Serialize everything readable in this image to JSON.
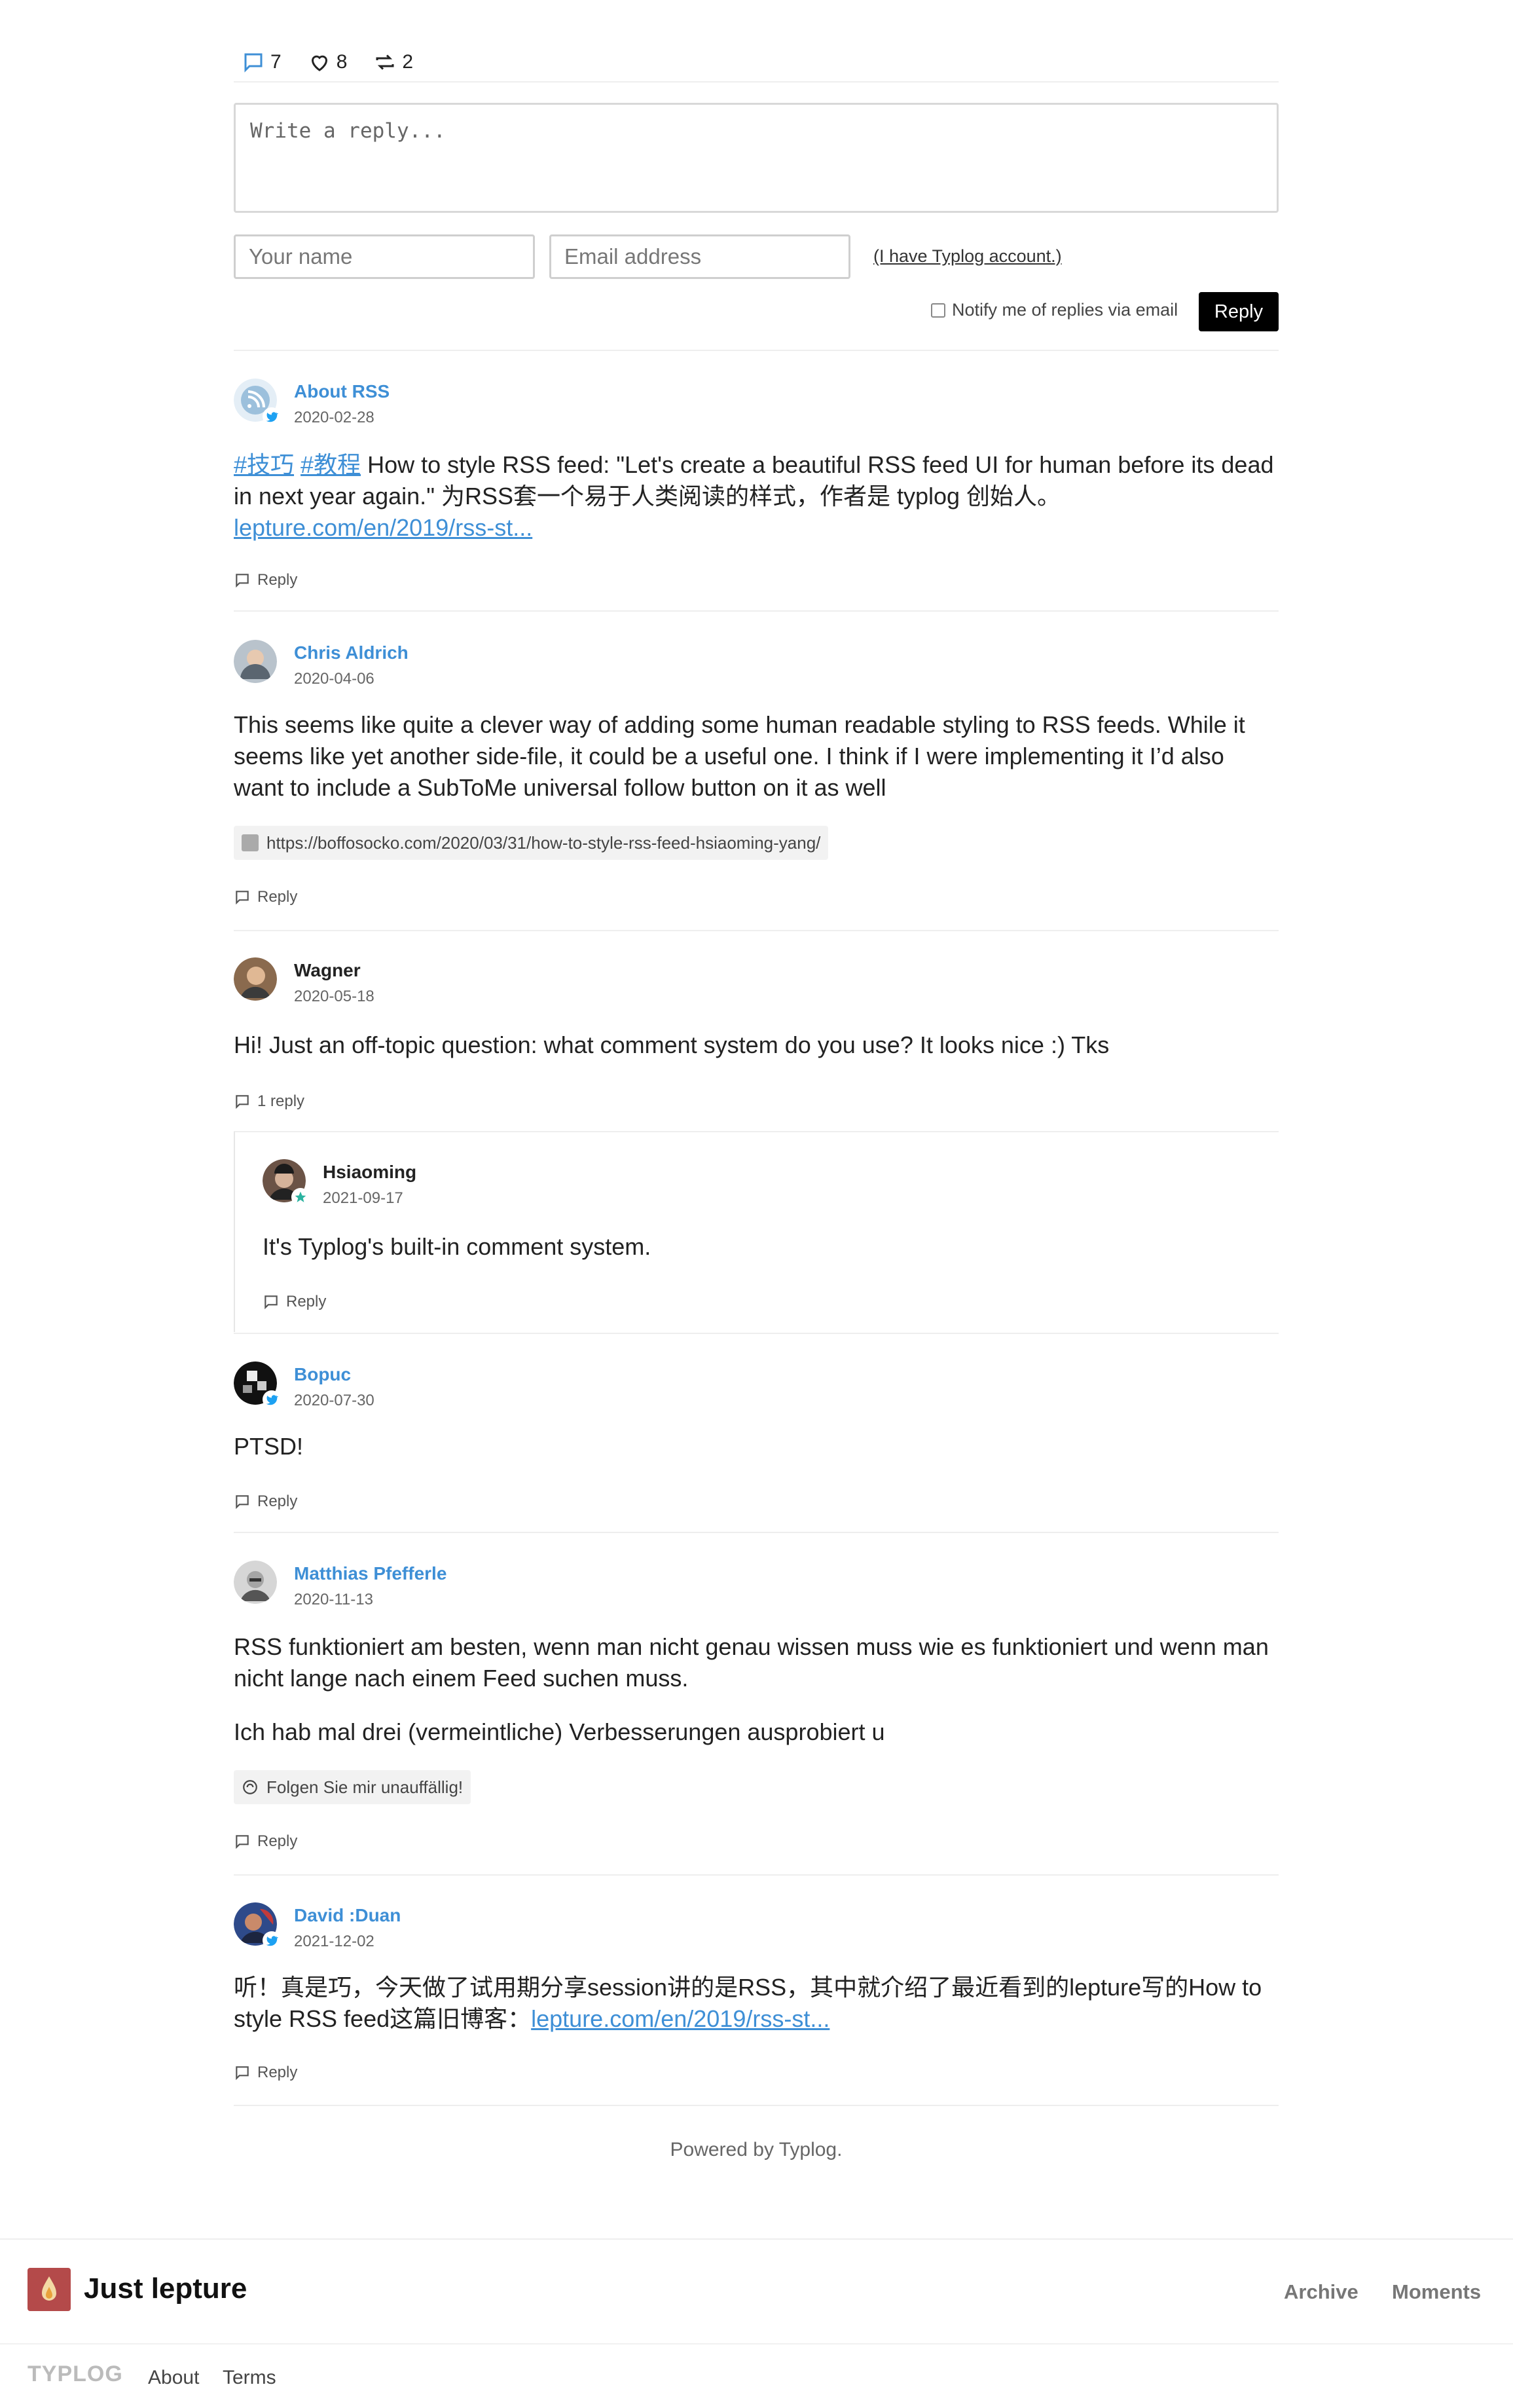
{
  "stats": {
    "comments": "7",
    "likes": "8",
    "reposts": "2"
  },
  "form": {
    "reply_placeholder": "Write a reply...",
    "name_placeholder": "Your name",
    "email_placeholder": "Email address",
    "account_link": "(I have Typlog account.)",
    "notify_label": "Notify me of replies via email",
    "submit_label": "Reply"
  },
  "comments": [
    {
      "author": "About RSS",
      "date": "2020-02-28",
      "tag1": "#技巧",
      "tag2": "#教程",
      "text": " How to style RSS feed: \"Let's create a beautiful RSS feed UI for human before its dead in next year again.\" 为RSS套一个易于人类阅读的样式，作者是 typlog 创始人。",
      "link": "lepture.com/en/2019/rss-st...",
      "reply_label": "Reply"
    },
    {
      "author": "Chris Aldrich",
      "date": "2020-04-06",
      "text": "This seems like quite a clever way of adding some human readable styling to RSS feeds. While it seems like yet another side-file, it could be a useful one. I think if I were implementing it I’d also want to include a SubToMe universal follow button on it as well",
      "card": "https://boffosocko.com/2020/03/31/how-to-style-rss-feed-hsiaoming-yang/",
      "reply_label": "Reply"
    },
    {
      "author": "Wagner",
      "date": "2020-05-18",
      "text": "Hi! Just an off-topic question: what comment system do you use? It looks nice :) Tks",
      "reply_label": "1 reply"
    },
    {
      "author": "Hsiaoming",
      "date": "2021-09-17",
      "text": "It's Typlog's built-in comment system.",
      "reply_label": "Reply"
    },
    {
      "author": "Bopuc",
      "date": "2020-07-30",
      "text": "PTSD!",
      "reply_label": "Reply"
    },
    {
      "author": "Matthias Pfefferle",
      "date": "2020-11-13",
      "text1": "RSS funktioniert am besten, wenn man nicht genau wissen muss wie es funktioniert und wenn man nicht lange nach einem Feed suchen muss.",
      "text2": "Ich hab mal drei (vermeintliche) Verbesserungen ausprobiert u",
      "card": "Folgen Sie mir unauffällig!",
      "reply_label": "Reply"
    },
    {
      "author": "David :Duan",
      "date": "2021-12-02",
      "text": "听！真是巧，今天做了试用期分享session讲的是RSS，其中就介绍了最近看到的lepture写的How to style RSS feed这篇旧博客：",
      "link": "lepture.com/en/2019/rss-st...",
      "reply_label": "Reply"
    }
  ],
  "powered": "Powered by Typlog.",
  "footer": {
    "site_title": "Just lepture",
    "nav": [
      "Archive",
      "Moments"
    ],
    "brand": "TYPLOG",
    "links": [
      "About",
      "Terms"
    ]
  },
  "colors": {
    "link": "#3e8fd6",
    "twitter": "#1da1f2",
    "logo": "#b44a4a"
  }
}
